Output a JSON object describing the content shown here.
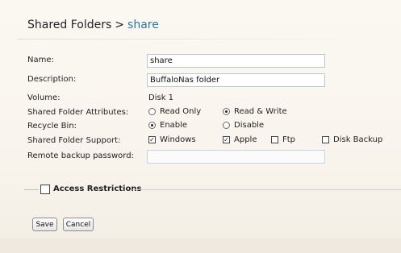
{
  "breadcrumb": {
    "parent": "Shared Folders",
    "separator": ">",
    "current": "share"
  },
  "form": {
    "name": {
      "label": "Name:",
      "value": "share"
    },
    "description": {
      "label": "Description:",
      "value": "BuffaloNas folder"
    },
    "volume": {
      "label": "Volume:",
      "value": "Disk 1"
    },
    "attributes": {
      "label": "Shared Folder Attributes:",
      "options": [
        "Read Only",
        "Read & Write"
      ],
      "selected": "Read & Write"
    },
    "recycle_bin": {
      "label": "Recycle Bin:",
      "options": [
        "Enable",
        "Disable"
      ],
      "selected": "Enable"
    },
    "support": {
      "label": "Shared Folder Support:",
      "windows": {
        "label": "Windows",
        "checked": true
      },
      "apple": {
        "label": "Apple",
        "checked": true
      },
      "ftp": {
        "label": "Ftp",
        "checked": false
      },
      "disk_backup": {
        "label": "Disk Backup",
        "checked": false
      }
    },
    "remote_backup_password": {
      "label": "Remote backup password:",
      "value": ""
    }
  },
  "access_restrictions": {
    "label": "Access Restrictions",
    "checked": false
  },
  "buttons": {
    "save": "Save",
    "cancel": "Cancel"
  },
  "colors": {
    "breadcrumb_current": "#2b78a8",
    "field_border": "#b9c7d6",
    "background": "#f4f0e8"
  },
  "icons": {
    "checkbox_checked": "check-mark",
    "radio_selected": "filled-dot"
  }
}
